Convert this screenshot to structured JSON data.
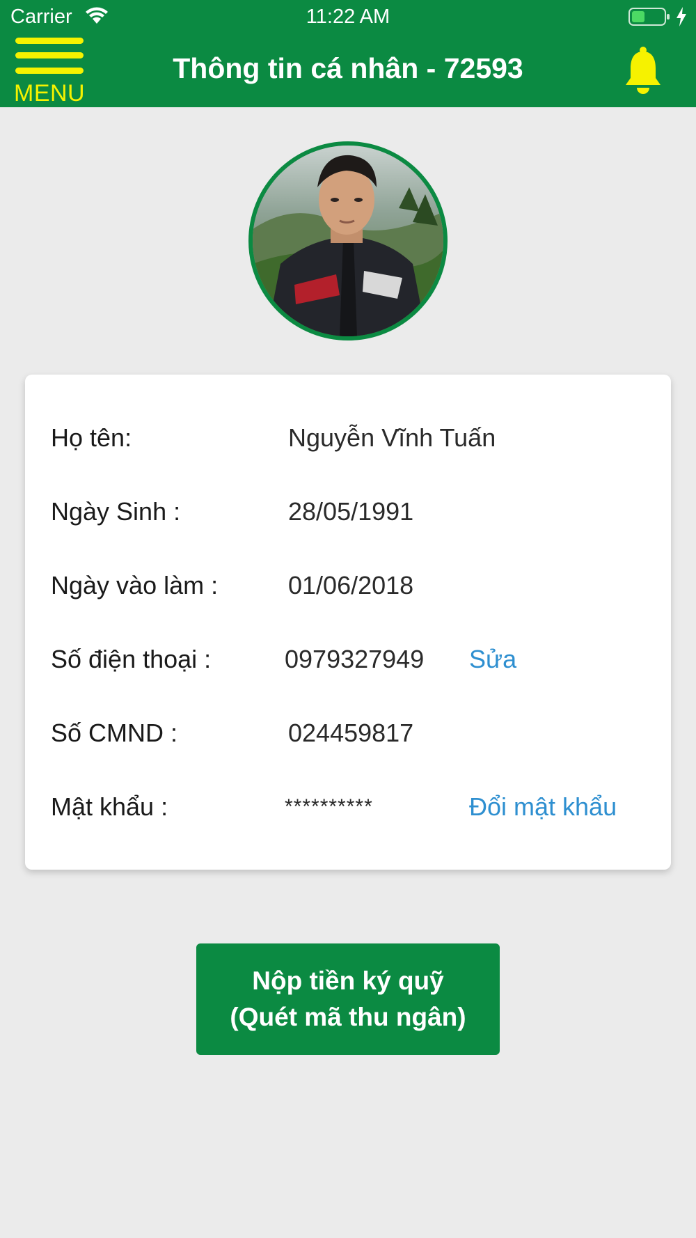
{
  "status_bar": {
    "carrier": "Carrier",
    "time": "11:22 AM"
  },
  "header": {
    "menu_label": "MENU",
    "title": "Thông tin cá nhân - 72593",
    "menu_icon": "hamburger-icon",
    "bell_icon": "bell-icon",
    "background_color": "#0b8a42",
    "accent_color": "#f6f200"
  },
  "profile": {
    "rows": [
      {
        "label": "Họ tên:",
        "value": "Nguyễn Vĩnh Tuấn"
      },
      {
        "label": "Ngày Sinh :",
        "value": "28/05/1991"
      },
      {
        "label": "Ngày vào làm :",
        "value": "01/06/2018"
      },
      {
        "label": "Số điện thoại :",
        "value": "0979327949",
        "action": "Sửa"
      },
      {
        "label": "Số CMND :",
        "value": "024459817"
      },
      {
        "label": "Mật khẩu :",
        "value": "**********",
        "action": "Đổi mật khẩu"
      }
    ],
    "link_color": "#2e8fd0"
  },
  "deposit_button": {
    "line1": "Nộp tiền ký quỹ",
    "line2": "(Quét mã thu ngân)"
  }
}
